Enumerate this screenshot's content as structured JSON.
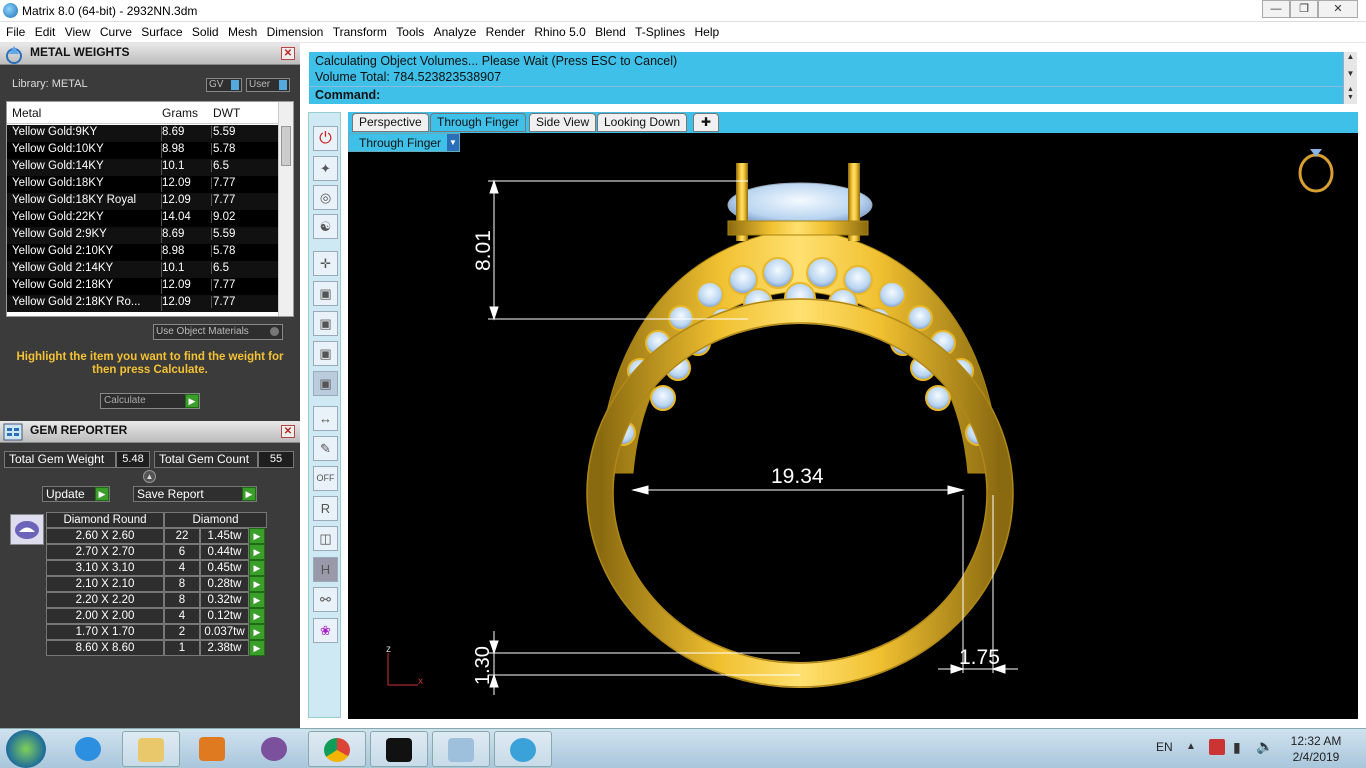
{
  "window": {
    "title": "Matrix 8.0 (64-bit) - 2932NN.3dm"
  },
  "menu": [
    "File",
    "Edit",
    "View",
    "Curve",
    "Surface",
    "Solid",
    "Mesh",
    "Dimension",
    "Transform",
    "Tools",
    "Analyze",
    "Render",
    "Rhino 5.0",
    "Blend",
    "T-Splines",
    "Help"
  ],
  "metal_weights": {
    "title": "METAL WEIGHTS",
    "library_label": "Library: METAL",
    "tag_gv": "GV",
    "tag_user": "User",
    "columns": [
      "Metal",
      "Grams",
      "DWT"
    ],
    "rows": [
      {
        "metal": "Yellow Gold:9KY",
        "grams": "8.69",
        "dwt": "5.59"
      },
      {
        "metal": "Yellow Gold:10KY",
        "grams": "8.98",
        "dwt": "5.78"
      },
      {
        "metal": "Yellow Gold:14KY",
        "grams": "10.1",
        "dwt": "6.5"
      },
      {
        "metal": "Yellow Gold:18KY",
        "grams": "12.09",
        "dwt": "7.77"
      },
      {
        "metal": "Yellow Gold:18KY Royal",
        "grams": "12.09",
        "dwt": "7.77"
      },
      {
        "metal": "Yellow Gold:22KY",
        "grams": "14.04",
        "dwt": "9.02"
      },
      {
        "metal": "Yellow Gold 2:9KY",
        "grams": "8.69",
        "dwt": "5.59"
      },
      {
        "metal": "Yellow Gold 2:10KY",
        "grams": "8.98",
        "dwt": "5.78"
      },
      {
        "metal": "Yellow Gold 2:14KY",
        "grams": "10.1",
        "dwt": "6.5"
      },
      {
        "metal": "Yellow Gold 2:18KY",
        "grams": "12.09",
        "dwt": "7.77"
      },
      {
        "metal": "Yellow Gold 2:18KY Ro...",
        "grams": "12.09",
        "dwt": "7.77"
      }
    ],
    "use_object_materials": "Use Object Materials",
    "instruction": "Highlight the item you want to find the weight for then press Calculate.",
    "calculate_label": "Calculate"
  },
  "gem_reporter": {
    "title": "GEM REPORTER",
    "total_weight_label": "Total Gem Weight",
    "total_weight": "5.48",
    "total_count_label": "Total Gem Count",
    "total_count": "55",
    "update_label": "Update",
    "save_report_label": "Save Report",
    "header_shape": "Diamond Round",
    "header_type": "Diamond",
    "rows": [
      {
        "size": "2.60 X 2.60",
        "count": "22",
        "weight": "1.45tw"
      },
      {
        "size": "2.70 X 2.70",
        "count": "6",
        "weight": "0.44tw"
      },
      {
        "size": "3.10 X 3.10",
        "count": "4",
        "weight": "0.45tw"
      },
      {
        "size": "2.10 X 2.10",
        "count": "8",
        "weight": "0.28tw"
      },
      {
        "size": "2.20 X 2.20",
        "count": "8",
        "weight": "0.32tw"
      },
      {
        "size": "2.00 X 2.00",
        "count": "4",
        "weight": "0.12tw"
      },
      {
        "size": "1.70 X 1.70",
        "count": "2",
        "weight": "0.037tw"
      },
      {
        "size": "8.60 X 8.60",
        "count": "1",
        "weight": "2.38tw"
      }
    ]
  },
  "command": {
    "line1": "Calculating Object Volumes... Please Wait (Press ESC to Cancel)",
    "line2": "Volume Total: 784.523823538907",
    "prompt": "Command:"
  },
  "viewtabs": [
    "Perspective",
    "Through Finger",
    "Side View",
    "Looking Down"
  ],
  "viewport": {
    "name": "Through Finger",
    "dim_height": "8.01",
    "dim_width": "19.34",
    "dim_band": "1.30",
    "dim_side": "1.75",
    "axis_z": "z",
    "axis_x": "x"
  },
  "taskbar": {
    "lang": "EN",
    "time": "12:32 AM",
    "date": "2/4/2019"
  }
}
